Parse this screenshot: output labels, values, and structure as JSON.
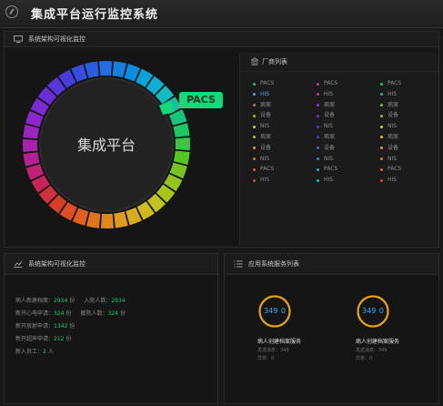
{
  "app": {
    "title": "集成平台运行监控系统"
  },
  "top_panel": {
    "title": "系统架构可视化监控",
    "center_label": "集成平台",
    "callout": "PACS"
  },
  "vendors": {
    "title": "厂商列表",
    "columns": [
      [
        {
          "label": "PACS",
          "color": "#17c964",
          "active": false
        },
        {
          "label": "HIS",
          "color": "#3fa9f5",
          "active": true
        },
        {
          "label": "病案",
          "color": "#a67c52",
          "active": false
        },
        {
          "label": "设备",
          "color": "#a3c121",
          "active": false
        },
        {
          "label": "NIS",
          "color": "#c7d61f",
          "active": false
        },
        {
          "label": "病案",
          "color": "#b8c122",
          "active": false
        },
        {
          "label": "设备",
          "color": "#e0a01f",
          "active": false
        },
        {
          "label": "NIS",
          "color": "#e07a1f",
          "active": false
        },
        {
          "label": "PACS",
          "color": "#e0601f",
          "active": false
        },
        {
          "label": "HIS",
          "color": "#d04a1f",
          "active": false
        }
      ],
      [
        {
          "label": "PACS",
          "color": "#c23b8a",
          "active": false
        },
        {
          "label": "HIS",
          "color": "#d0309a",
          "active": false
        },
        {
          "label": "病案",
          "color": "#9a2ed8",
          "active": false
        },
        {
          "label": "设备",
          "color": "#7a2ed8",
          "active": false
        },
        {
          "label": "NIS",
          "color": "#5a2ed8",
          "active": false
        },
        {
          "label": "病案",
          "color": "#3a3ee0",
          "active": false
        },
        {
          "label": "设备",
          "color": "#2b6fe0",
          "active": false
        },
        {
          "label": "NIS",
          "color": "#1f8fe0",
          "active": false
        },
        {
          "label": "PACS",
          "color": "#1faae0",
          "active": false
        },
        {
          "label": "HIS",
          "color": "#1fbad8",
          "active": false
        }
      ],
      [
        {
          "label": "PACS",
          "color": "#17c964",
          "active": false
        },
        {
          "label": "HIS",
          "color": "#18c97a",
          "active": false
        },
        {
          "label": "病案",
          "color": "#7fc21f",
          "active": false
        },
        {
          "label": "设备",
          "color": "#a3c121",
          "active": false
        },
        {
          "label": "NIS",
          "color": "#c7d61f",
          "active": false
        },
        {
          "label": "病案",
          "color": "#d8c21f",
          "active": false
        },
        {
          "label": "设备",
          "color": "#e0a01f",
          "active": false
        },
        {
          "label": "NIS",
          "color": "#e07a1f",
          "active": false
        },
        {
          "label": "PACS",
          "color": "#e0601f",
          "active": false
        },
        {
          "label": "HIS",
          "color": "#d04a1f",
          "active": false
        }
      ]
    ]
  },
  "stats_panel": {
    "title": "系统架构可视化监控",
    "rows": [
      {
        "label": "病人新建档案：",
        "value": "2934",
        "unit": "份",
        "label2": "入院人数：",
        "value2": "2934"
      },
      {
        "label": "新开心电申请：",
        "value": "324",
        "unit": "份",
        "label2": "撤院人数：",
        "value2": "324",
        "unit2": "份"
      },
      {
        "label": "新开放射申请：",
        "value": "1342",
        "unit": "份"
      },
      {
        "label": "新开超声申请：",
        "value": "212",
        "unit": "份"
      },
      {
        "label": "新入员工：",
        "value": "2",
        "unit": "人"
      }
    ]
  },
  "services_panel": {
    "title": "应用系统服务列表",
    "items": [
      {
        "value": "349",
        "progress": "0",
        "name": "病人创建档案服务",
        "sub1": "发送消息：349",
        "sub2": "异常：0"
      },
      {
        "value": "349",
        "progress": "0",
        "name": "病人创建档案服务",
        "sub1": "发送消息：349",
        "sub2": "异常：0"
      }
    ]
  },
  "colors": {
    "accent": "#13d97a",
    "value_green": "#19d36f",
    "value_blue": "#3fa9f5",
    "gauge_orange": "#e8a316"
  }
}
